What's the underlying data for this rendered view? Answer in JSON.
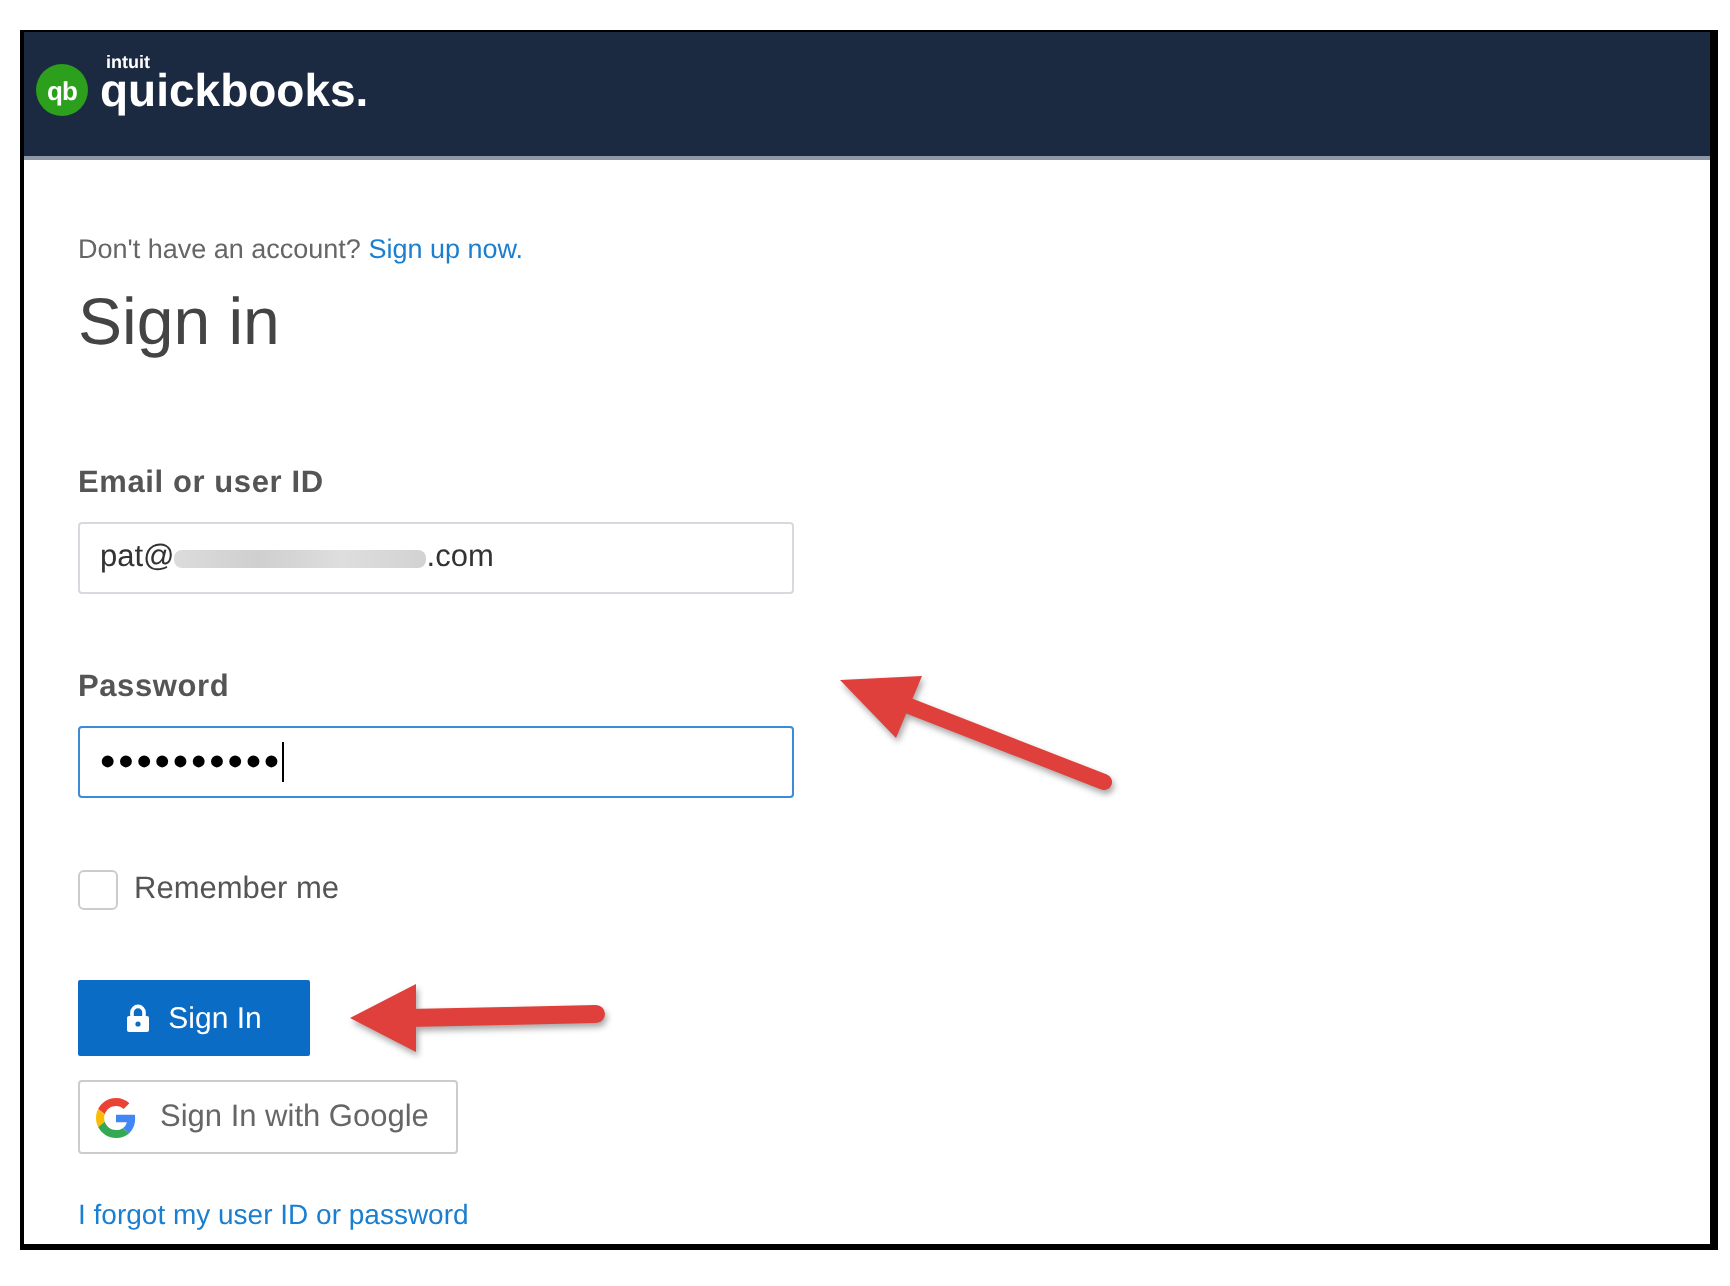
{
  "header": {
    "logo_mark": "qb",
    "logo_small": "intuit",
    "logo_name": "quickbooks."
  },
  "signup": {
    "prompt": "Don't have an account?",
    "link": "Sign up now."
  },
  "title": "Sign in",
  "fields": [
    {
      "label": "Email or user ID",
      "value_start": "pat@",
      "redacted": true,
      "value_end": ".com",
      "focused": false
    },
    {
      "label": "Password",
      "value_start": "••••••••••",
      "focused": true
    }
  ],
  "remember": {
    "label": "Remember me",
    "checked": false
  },
  "sign_in_button": {
    "label": "Sign In"
  },
  "google_button": {
    "label": "Sign In with Google"
  },
  "forgot_link": "I forgot my user ID or password"
}
